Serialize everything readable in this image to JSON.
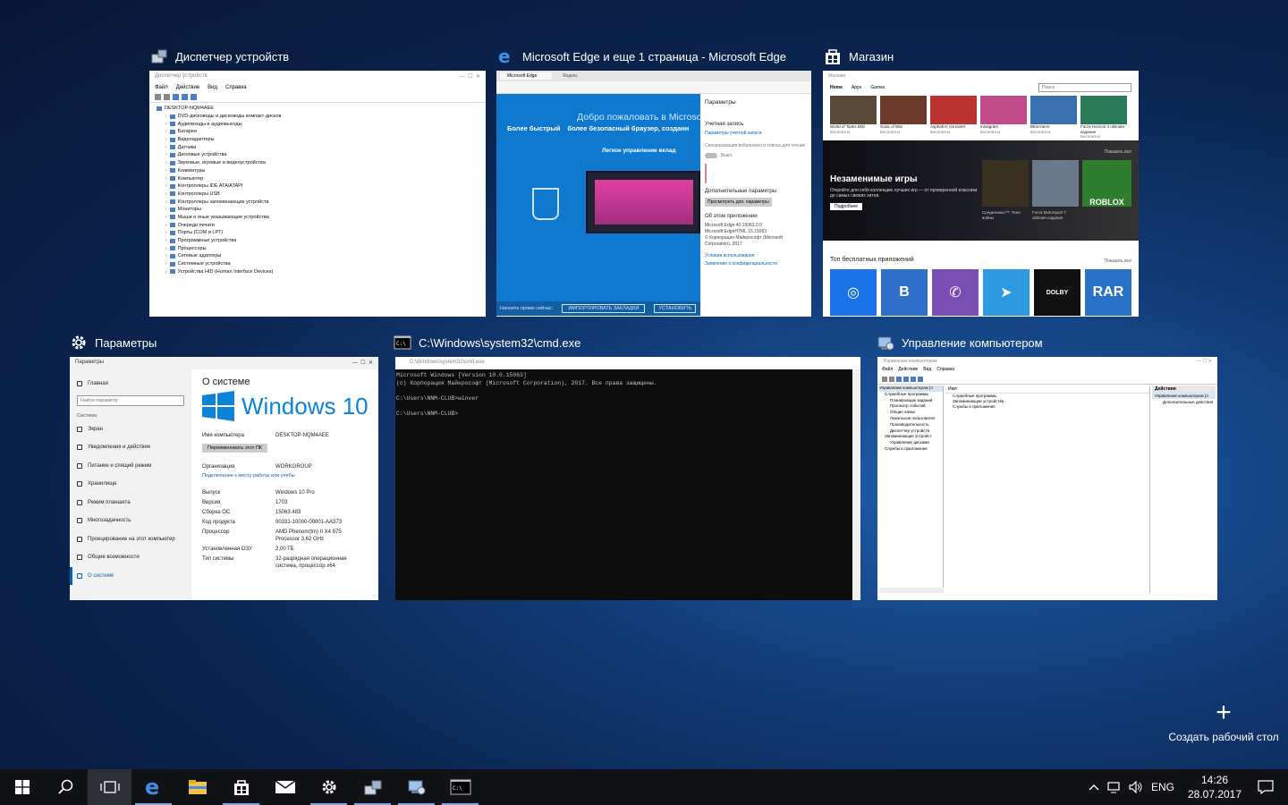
{
  "windows": {
    "devmgr": {
      "caption": "Диспетчер устройств",
      "title": "Диспетчер устройств",
      "menu": [
        "Файл",
        "Действие",
        "Вид",
        "Справка"
      ],
      "root": "DESKTOP-NQM4AEE",
      "items": [
        "DVD-дисководы и дисководы компакт-дисков",
        "Аудиовходы и аудиовыходы",
        "Батареи",
        "Видеоадаптеры",
        "Датчики",
        "Дисковые устройства",
        "Звуковые, игровые и видеоустройства",
        "Клавиатуры",
        "Компьютер",
        "Контроллеры IDE ATA/ATAPI",
        "Контроллеры USB",
        "Контроллеры запоминающих устройств",
        "Мониторы",
        "Мыши и иные указывающие устройства",
        "Очереди печати",
        "Порты (COM и LPT)",
        "Программные устройства",
        "Процессоры",
        "Сетевые адаптеры",
        "Системные устройства",
        "Устройства HID (Human Interface Devices)"
      ]
    },
    "edge": {
      "caption": "Microsoft Edge и еще 1 страница - Microsoft Edge",
      "tab1": "Microsoft Edge",
      "tab2": "Яндекс",
      "welcome": "Добро пожаловать в Microsoft",
      "sub1": "Более быстрый",
      "sub2": "более безопасный браузер, созданн",
      "easy": "Легкое управление вклад",
      "import_prompt": "Начните прямо сейчас:",
      "import_btn": "ИМПОРТИРОВАТЬ ЗАКЛАДКИ",
      "install_btn": "УСТАНОВИТЬ",
      "panel": {
        "title": "Параметры",
        "account": "Учетная запись",
        "account_link": "Параметры учетной записи",
        "sync": "Синхронизация избранного и списка для чтения",
        "toggle": "Выкл.",
        "advanced": "Дополнительные параметры",
        "advanced_btn": "Просмотреть доп. параметры",
        "about": "Об этом приложении",
        "about_lines": [
          "Microsoft Edge 40.15063.0.0",
          "Microsoft EdgeHTML 15.15063",
          "© Корпорация Майкрософт (Microsoft",
          "Corporation), 2017"
        ],
        "terms": "Условия использования",
        "privacy": "Заявление о конфиденциальности"
      }
    },
    "store": {
      "caption": "Магазин",
      "title": "Магазин",
      "nav": [
        "Home",
        "Apps",
        "Games"
      ],
      "search": "Поиск",
      "top_apps": [
        "World of Tanks Blitz",
        "Gods of War",
        "Asphalt 8: На взлет",
        "Instagram",
        "ВКонтакте",
        "Forza Horizon 3 ultimate-издание"
      ],
      "free_label": "Бесплатно",
      "banner_title": "Незаменимые игры",
      "banner_text": "Откройте для себя коллекцию лучших игр — от проверенной классики до самых свежих хитов.",
      "banner_btn": "Подробнее",
      "show_all": "Показать все",
      "games": [
        "Средиземье™: Тени войны",
        "Forza Motorsport 7 ultimate-издание",
        "ROBLOX"
      ],
      "free_apps": "Топ бесплатных приложений",
      "tiles": [
        {
          "label": "◎",
          "color": "#1a73e8"
        },
        {
          "label": "B",
          "color": "#2f6fc9"
        },
        {
          "label": "✆",
          "color": "#7a4fb5"
        },
        {
          "label": "➤",
          "color": "#2e9be0"
        },
        {
          "label": "DOLBY",
          "color": "#111111"
        },
        {
          "label": "RAR",
          "color": "#2a72c8"
        }
      ]
    },
    "settings": {
      "caption": "Параметры",
      "title": "Параметры",
      "home": "Главная",
      "search": "Найти параметр",
      "section": "Система",
      "nav": [
        "Экран",
        "Уведомления и действия",
        "Питание и спящий режим",
        "Хранилище",
        "Режим планшета",
        "Многозадачность",
        "Проецирование на этот компьютер",
        "Общие возможности",
        "О системе"
      ],
      "heading": "О системе",
      "logo_text": "Windows 10",
      "pc_name_label": "Имя компьютера",
      "pc_name": "DESKTOP-NQM4AEE",
      "rename_btn": "Переименовать этот ПК",
      "org_label": "Организация",
      "org": "WORKGROUP",
      "connect_link": "Подключение к месту работы или учебы",
      "rows": [
        {
          "k": "Выпуск",
          "v": "Windows 10 Pro"
        },
        {
          "k": "Версия",
          "v": "1703"
        },
        {
          "k": "Сборка ОС",
          "v": "15063.483"
        },
        {
          "k": "Код продукта",
          "v": "00331-10000-00001-AA373"
        },
        {
          "k": "Процессор",
          "v": "AMD Phenom(tm) II X4 975 Processor   3.62 GHz"
        },
        {
          "k": "Установленная ОЗУ",
          "v": "2,00 ГБ"
        },
        {
          "k": "Тип системы",
          "v": "32-разрядная операционная система, процессор x64"
        }
      ]
    },
    "cmd": {
      "caption": "C:\\Windows\\system32\\cmd.exe",
      "title": "C:\\Windows\\system32\\cmd.exe",
      "lines": [
        "Microsoft Windows [Version 10.0.15063]",
        "(c) Корпорация Майкрософт (Microsoft Corporation), 2017. Все права защищены.",
        "",
        "C:\\Users\\NNM-CLUB>winver",
        "",
        "C:\\Users\\NNM-CLUB>"
      ]
    },
    "compmgmt": {
      "caption": "Управление компьютером",
      "title": "Управление компьютером",
      "menu": [
        "Файл",
        "Действие",
        "Вид",
        "Справка"
      ],
      "tree": [
        "Управление компьютером (л",
        "Служебные программы",
        "Планировщик заданий",
        "Просмотр событий",
        "Общие папки",
        "Локальные пользовател",
        "Производительность",
        "Диспетчер устройств",
        "Запоминающие устройст",
        "Управление дисками",
        "Службы и приложения"
      ],
      "list_header": "Имя",
      "list": [
        "Служебные программы",
        "Запоминающие устройства",
        "Службы и приложения"
      ],
      "actions_header": "Действия",
      "actions": [
        "Управление компьютером (л",
        "Дополнительные действия"
      ]
    }
  },
  "new_desktop": "Создать рабочий стол",
  "tray": {
    "lang": "ENG",
    "time": "14:26",
    "date": "28.07.2017"
  }
}
